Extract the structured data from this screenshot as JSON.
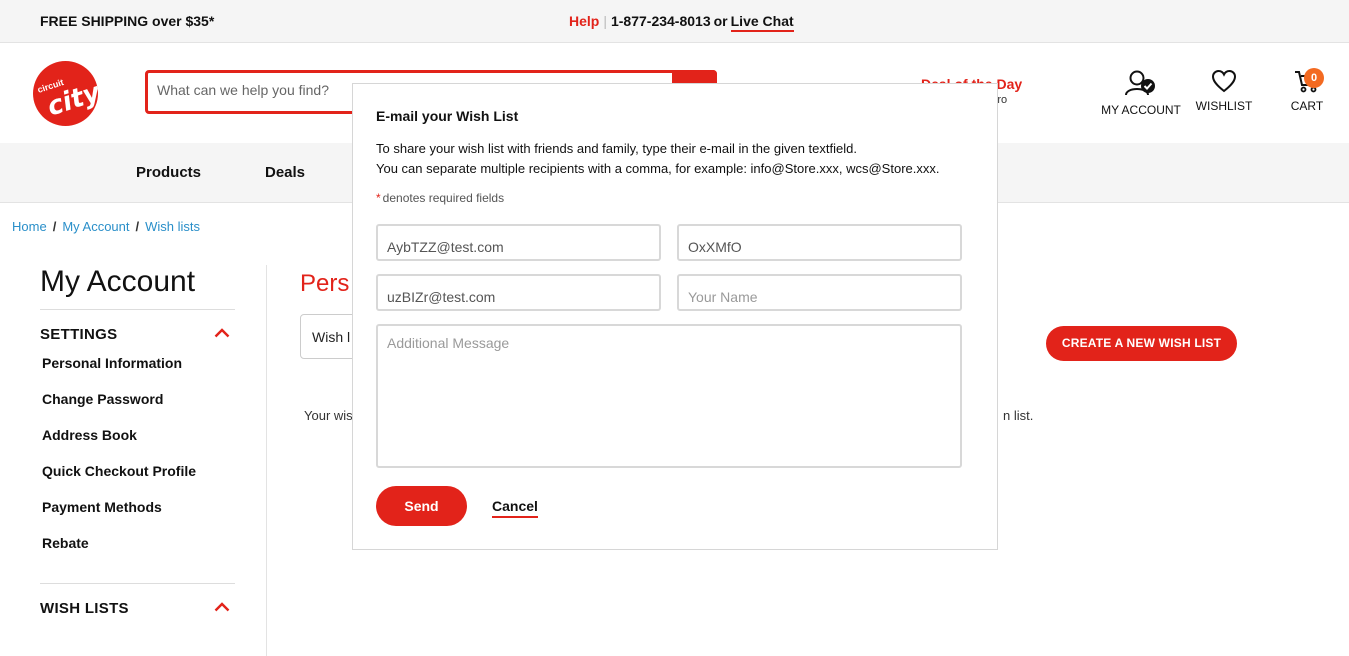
{
  "topbar": {
    "shipping": "FREE SHIPPING over $35*",
    "help": "Help",
    "separator": "|",
    "phone": "1-877-234-8013",
    "or": "or",
    "live_chat": "Live Chat"
  },
  "header": {
    "logo_top": "circuit",
    "logo_main": "city",
    "search_placeholder": "What can we help you find?",
    "deal": "Deal of the Day",
    "deal_sub": "Pro",
    "my_account": "MY ACCOUNT",
    "wishlist": "WISHLIST",
    "cart": "CART",
    "cart_count": "0"
  },
  "nav": {
    "products": "Products",
    "deals": "Deals"
  },
  "breadcrumb": {
    "home": "Home",
    "my_account": "My Account",
    "wish_lists": "Wish lists",
    "sep": "/"
  },
  "sidebar": {
    "title": "My Account",
    "settings": "SETTINGS",
    "links": [
      "Personal Information",
      "Change Password",
      "Address Book",
      "Quick Checkout Profile",
      "Payment Methods",
      "Rebate"
    ],
    "wish_lists": "WISH LISTS"
  },
  "main": {
    "heading_partial": "Pers",
    "select_partial": "Wish l",
    "create_button": "CREATE A NEW WISH LIST",
    "text_partial": "Your wis",
    "text_tail": "n list."
  },
  "modal": {
    "title": "E-mail your Wish List",
    "desc1": "To share your wish list with friends and family, type their e-mail in the given textfield.",
    "desc2": "You can separate multiple recipients with a comma, for example: info@Store.xxx, wcs@Store.xxx.",
    "required_star": "*",
    "required_note": "denotes required fields",
    "field1_value": "AybTZZ@test.com",
    "field2_value": "OxXMfO",
    "field3_value": "uzBIZr@test.com",
    "field4_placeholder": "Your Name",
    "message_placeholder": "Additional Message",
    "send": "Send",
    "cancel": "Cancel"
  },
  "colors": {
    "brand_red": "#e2231a",
    "link_blue": "#2a8fc9",
    "badge_orange": "#f36a21"
  }
}
